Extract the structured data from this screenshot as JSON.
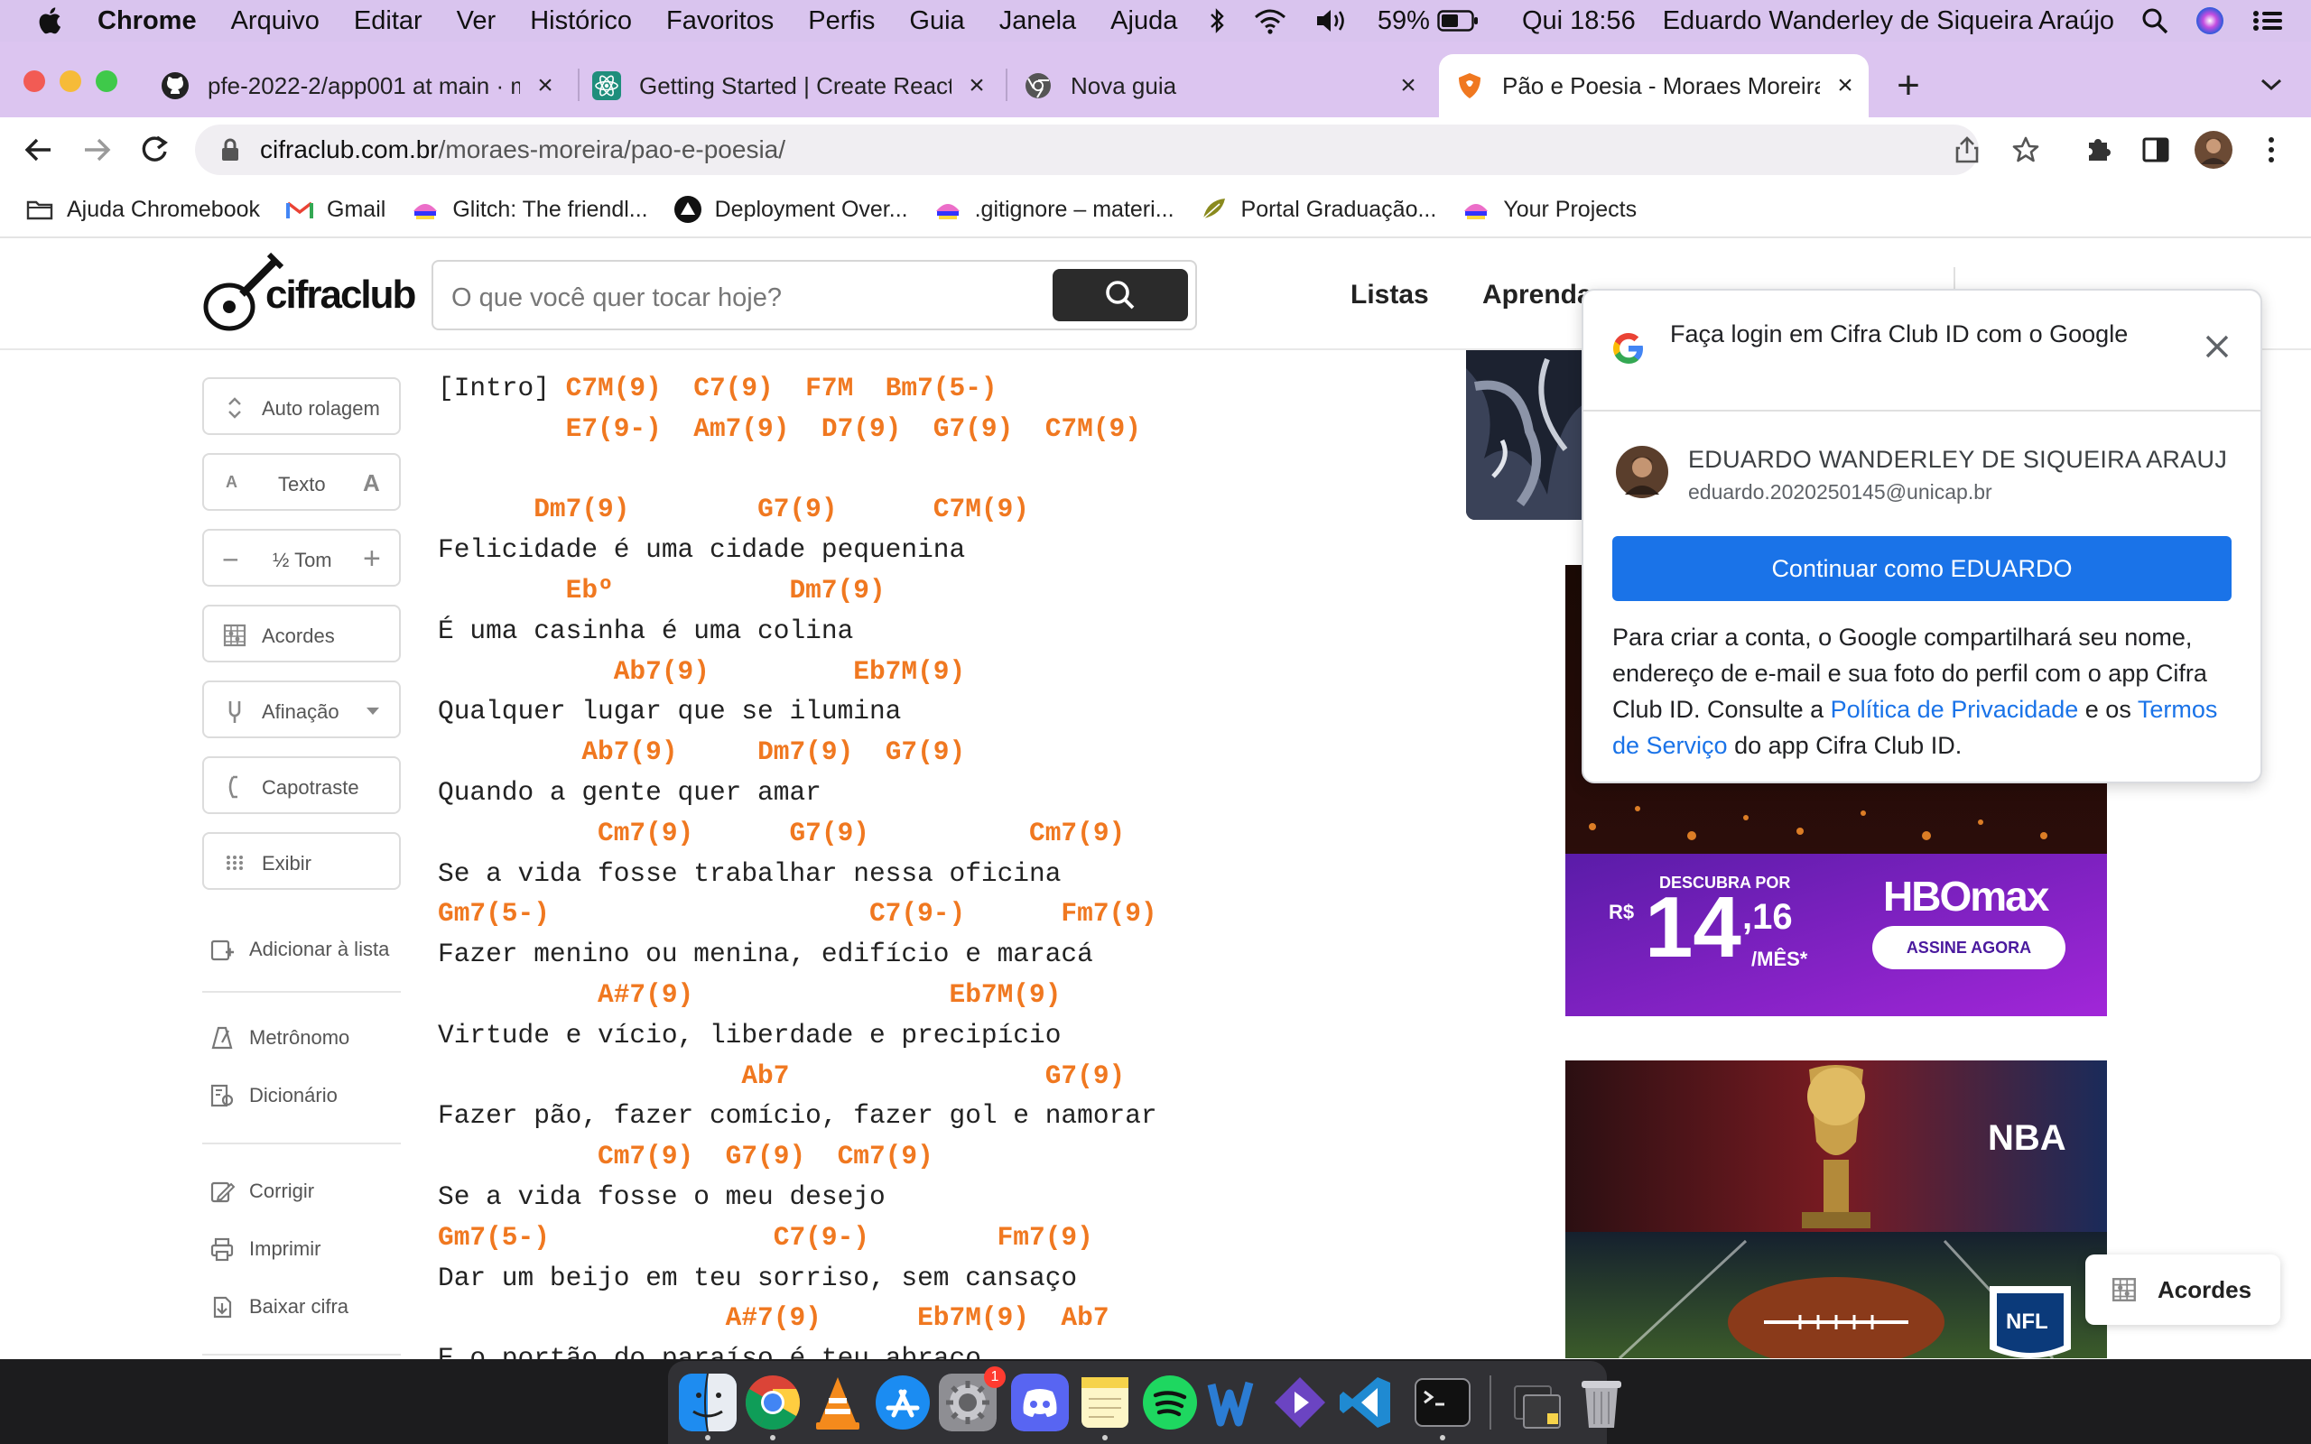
{
  "menubar": {
    "app": "Chrome",
    "items": [
      "Arquivo",
      "Editar",
      "Ver",
      "Histórico",
      "Favoritos",
      "Perfis",
      "Guia",
      "Janela",
      "Ajuda"
    ],
    "battery": "59%",
    "clock": "Qui 18:56",
    "user": "Eduardo Wanderley de Siqueira Araújo"
  },
  "tabs": [
    {
      "title": "pfe-2022-2/app001 at main · m",
      "icon": "github-icon"
    },
    {
      "title": "Getting Started | Create React",
      "icon": "react-icon"
    },
    {
      "title": "Nova guia",
      "icon": "chrome-icon"
    },
    {
      "title": "Pão e Poesia - Moraes Moreira",
      "icon": "cifraclub-icon"
    }
  ],
  "omnibox": {
    "host": "cifraclub.com.br",
    "path": "/moraes-moreira/pao-e-poesia/"
  },
  "bookmarks": [
    "Ajuda Chromebook",
    "Gmail",
    "Glitch: The friendl...",
    "Deployment Over...",
    ".gitignore – materi...",
    "Portal Graduação...",
    "Your Projects"
  ],
  "site": {
    "logo": "cifraclub",
    "search_placeholder": "O que você quer tocar hoje?",
    "nav": [
      "Listas",
      "Aprenda"
    ]
  },
  "sidebar": {
    "auto": "Auto rolagem",
    "texto": "Texto",
    "tom": "½ Tom",
    "acordes": "Acordes",
    "afinacao": "Afinação",
    "capotraste": "Capotraste",
    "exibir": "Exibir",
    "adicionar": "Adicionar à lista",
    "metronomo": "Metrônomo",
    "dicionario": "Dicionário",
    "corrigir": "Corrigir",
    "imprimir": "Imprimir",
    "baixar": "Baixar cifra"
  },
  "song": {
    "lines": [
      {
        "t": "c",
        "segs": [
          [
            "l",
            "[Intro] "
          ],
          [
            "c",
            "C7M(9)"
          ],
          [
            "l",
            "  "
          ],
          [
            "c",
            "C7(9)"
          ],
          [
            "l",
            "  "
          ],
          [
            "c",
            "F7M"
          ],
          [
            "l",
            "  "
          ],
          [
            "c",
            "Bm7(5-)"
          ]
        ]
      },
      {
        "t": "c",
        "segs": [
          [
            "l",
            "        "
          ],
          [
            "c",
            "E7(9-)"
          ],
          [
            "l",
            "  "
          ],
          [
            "c",
            "Am7(9)"
          ],
          [
            "l",
            "  "
          ],
          [
            "c",
            "D7(9)"
          ],
          [
            "l",
            "  "
          ],
          [
            "c",
            "G7(9)"
          ],
          [
            "l",
            "  "
          ],
          [
            "c",
            "C7M(9)"
          ]
        ]
      },
      {
        "t": "l",
        "segs": [
          [
            "l",
            ""
          ]
        ]
      },
      {
        "t": "c",
        "segs": [
          [
            "l",
            "      "
          ],
          [
            "c",
            "Dm7(9)"
          ],
          [
            "l",
            "        "
          ],
          [
            "c",
            "G7(9)"
          ],
          [
            "l",
            "      "
          ],
          [
            "c",
            "C7M(9)"
          ]
        ]
      },
      {
        "t": "l",
        "segs": [
          [
            "l",
            "Felicidade é uma cidade pequenina"
          ]
        ]
      },
      {
        "t": "c",
        "segs": [
          [
            "l",
            "        "
          ],
          [
            "c",
            "Ebº"
          ],
          [
            "l",
            "           "
          ],
          [
            "c",
            "Dm7(9)"
          ]
        ]
      },
      {
        "t": "l",
        "segs": [
          [
            "l",
            "É uma casinha é uma colina"
          ]
        ]
      },
      {
        "t": "c",
        "segs": [
          [
            "l",
            "           "
          ],
          [
            "c",
            "Ab7(9)"
          ],
          [
            "l",
            "         "
          ],
          [
            "c",
            "Eb7M(9)"
          ]
        ]
      },
      {
        "t": "l",
        "segs": [
          [
            "l",
            "Qualquer lugar que se ilumina"
          ]
        ]
      },
      {
        "t": "c",
        "segs": [
          [
            "l",
            "         "
          ],
          [
            "c",
            "Ab7(9)"
          ],
          [
            "l",
            "     "
          ],
          [
            "c",
            "Dm7(9)"
          ],
          [
            "l",
            "  "
          ],
          [
            "c",
            "G7(9)"
          ]
        ]
      },
      {
        "t": "l",
        "segs": [
          [
            "l",
            "Quando a gente quer amar"
          ]
        ]
      },
      {
        "t": "c",
        "segs": [
          [
            "l",
            "          "
          ],
          [
            "c",
            "Cm7(9)"
          ],
          [
            "l",
            "      "
          ],
          [
            "c",
            "G7(9)"
          ],
          [
            "l",
            "          "
          ],
          [
            "c",
            "Cm7(9)"
          ]
        ]
      },
      {
        "t": "l",
        "segs": [
          [
            "l",
            "Se a vida fosse trabalhar nessa oficina"
          ]
        ]
      },
      {
        "t": "c",
        "segs": [
          [
            "c",
            "Gm7(5-)"
          ],
          [
            "l",
            "                    "
          ],
          [
            "c",
            "C7(9-)"
          ],
          [
            "l",
            "      "
          ],
          [
            "c",
            "Fm7(9)"
          ]
        ]
      },
      {
        "t": "l",
        "segs": [
          [
            "l",
            "Fazer menino ou menina, edifício e maracá"
          ]
        ]
      },
      {
        "t": "c",
        "segs": [
          [
            "l",
            "          "
          ],
          [
            "c",
            "A#7(9)"
          ],
          [
            "l",
            "                "
          ],
          [
            "c",
            "Eb7M(9)"
          ]
        ]
      },
      {
        "t": "l",
        "segs": [
          [
            "l",
            "Virtude e vício, liberdade e precipício"
          ]
        ]
      },
      {
        "t": "c",
        "segs": [
          [
            "l",
            "                   "
          ],
          [
            "c",
            "Ab7"
          ],
          [
            "l",
            "                "
          ],
          [
            "c",
            "G7(9)"
          ]
        ]
      },
      {
        "t": "l",
        "segs": [
          [
            "l",
            "Fazer pão, fazer comício, fazer gol e namorar"
          ]
        ]
      },
      {
        "t": "c",
        "segs": [
          [
            "l",
            "          "
          ],
          [
            "c",
            "Cm7(9)"
          ],
          [
            "l",
            "  "
          ],
          [
            "c",
            "G7(9)"
          ],
          [
            "l",
            "  "
          ],
          [
            "c",
            "Cm7(9)"
          ]
        ]
      },
      {
        "t": "l",
        "segs": [
          [
            "l",
            "Se a vida fosse o meu desejo"
          ]
        ]
      },
      {
        "t": "c",
        "segs": [
          [
            "c",
            "Gm7(5-)"
          ],
          [
            "l",
            "              "
          ],
          [
            "c",
            "C7(9-)"
          ],
          [
            "l",
            "        "
          ],
          [
            "c",
            "Fm7(9)"
          ]
        ]
      },
      {
        "t": "l",
        "segs": [
          [
            "l",
            "Dar um beijo em teu sorriso, sem cansaço"
          ]
        ]
      },
      {
        "t": "c",
        "segs": [
          [
            "l",
            "                  "
          ],
          [
            "c",
            "A#7(9)"
          ],
          [
            "l",
            "      "
          ],
          [
            "c",
            "Eb7M(9)"
          ],
          [
            "l",
            "  "
          ],
          [
            "c",
            "Ab7"
          ]
        ]
      },
      {
        "t": "l",
        "segs": [
          [
            "l",
            "E o portão do paraíso é teu abraço"
          ]
        ]
      }
    ]
  },
  "ads": {
    "hbo_cta": "DESCUBRA POR",
    "hbo_currency": "R$",
    "hbo_price_int": "14",
    "hbo_price_dec": ",16",
    "hbo_per": "/MÊS*",
    "hbo_brand": "HBOmax",
    "hbo_button": "ASSINE AGORA",
    "nba_logo": "NBA",
    "nfl_logo": "NFL"
  },
  "google_popup": {
    "title": "Faça login em Cifra Club ID com o Google",
    "user_name": "EDUARDO WANDERLEY DE SIQUEIRA ARAUJ",
    "user_email": "eduardo.2020250145@unicap.br",
    "continue": "Continuar como EDUARDO",
    "text1": "Para criar a conta, o Google compartilhará seu nome, endereço de e-mail e sua foto do perfil com o app Cifra Club ID. Consulte a ",
    "privacy": "Política de Privacidade",
    "text2": " e os ",
    "terms": "Termos de Serviço",
    "text3": " do app Cifra Club ID."
  },
  "fab": {
    "label": "Acordes"
  },
  "dock": {
    "badge": "1",
    "apps": [
      "finder-icon",
      "chrome-icon",
      "vlc-icon",
      "app-store-icon",
      "system-preferences-icon",
      "discord-icon",
      "notes-icon",
      "spotify-icon",
      "word-icon",
      "visual-studio-icon",
      "vscode-icon",
      "terminal-icon",
      "downloads-stack-icon",
      "trash-icon"
    ]
  }
}
